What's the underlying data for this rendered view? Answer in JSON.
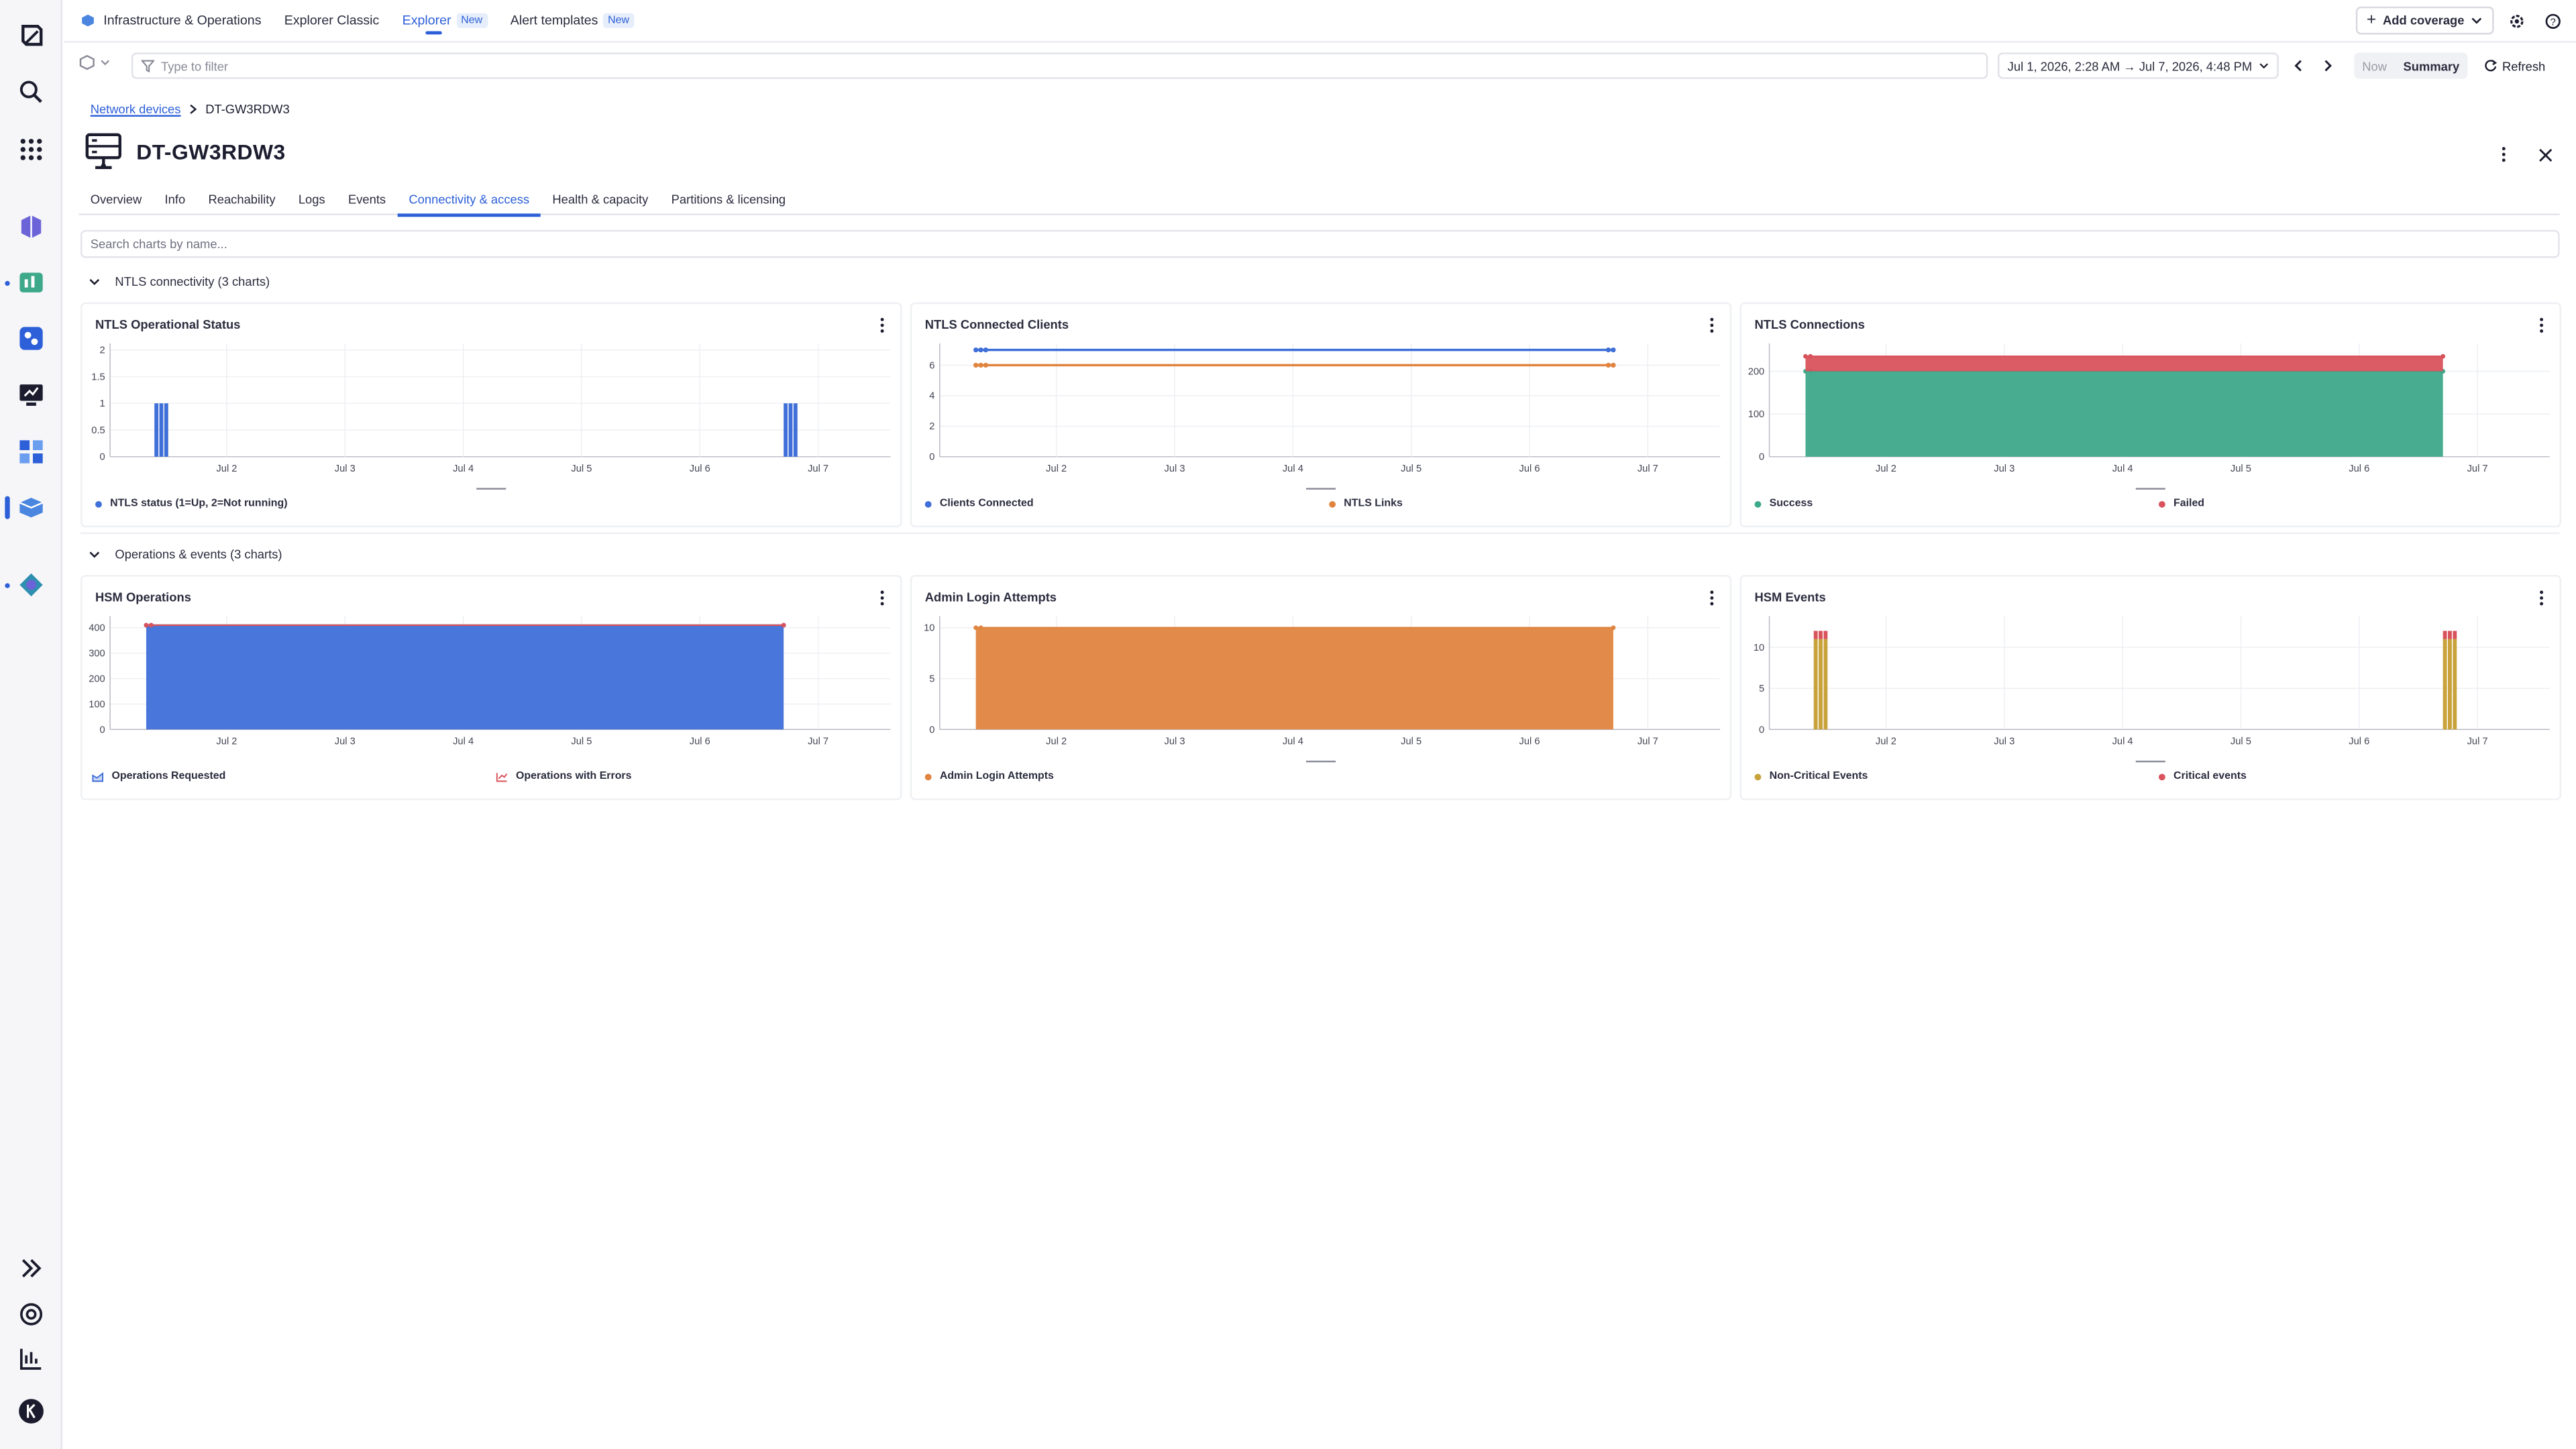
{
  "colors": {
    "accent": "#2c5fd8",
    "blue_series": "#3f6fd8",
    "orange_series": "#e0843f",
    "green_series": "#3ea98a",
    "red_series": "#d9535c",
    "olive_series": "#c8a23a"
  },
  "nav": {
    "app_name": "Infrastructure & Operations",
    "tabs": [
      {
        "label": "Explorer Classic",
        "badge": ""
      },
      {
        "label": "Explorer",
        "badge": "New"
      },
      {
        "label": "Alert templates",
        "badge": "New"
      }
    ],
    "add_coverage": "Add coverage"
  },
  "filter": {
    "placeholder": "Type to filter",
    "timeframe": "Jul 1, 2026, 2:28 AM → Jul 7, 2026, 4:48 PM",
    "now": "Now",
    "summary": "Summary",
    "refresh": "Refresh"
  },
  "breadcrumb": {
    "parent": "Network devices",
    "current": "DT-GW3RDW3"
  },
  "page": {
    "title": "DT-GW3RDW3"
  },
  "tabs": [
    "Overview",
    "Info",
    "Reachability",
    "Logs",
    "Events",
    "Connectivity & access",
    "Health & capacity",
    "Partitions & licensing"
  ],
  "search": {
    "placeholder": "Search charts by name..."
  },
  "sections": [
    {
      "title": "NTLS connectivity (3 charts)"
    },
    {
      "title": "Operations & events (3 charts)"
    }
  ],
  "chart_data": [
    {
      "type": "bar",
      "title": "NTLS Operational Status",
      "x_ticks": [
        "Jul 2",
        "Jul 3",
        "Jul 4",
        "Jul 5",
        "Jul 6",
        "Jul 7"
      ],
      "y_ticks": [
        "0",
        "0.5",
        "1",
        "1.5",
        "2"
      ],
      "ylim": [
        0,
        2
      ],
      "series": [
        {
          "name": "NTLS status (1=Up, 2=Not running)",
          "color": "#3f6fd8",
          "points": [
            {
              "x": "Jul 1",
              "y": 1
            },
            {
              "x": "Jul 6",
              "y": 1
            }
          ]
        }
      ],
      "legend": [
        "NTLS status (1=Up, 2=Not running)"
      ]
    },
    {
      "type": "line",
      "title": "NTLS Connected Clients",
      "x_ticks": [
        "Jul 2",
        "Jul 3",
        "Jul 4",
        "Jul 5",
        "Jul 6",
        "Jul 7"
      ],
      "y_ticks": [
        "0",
        "2",
        "4",
        "6"
      ],
      "ylim": [
        0,
        7
      ],
      "series": [
        {
          "name": "Clients Connected",
          "color": "#3f6fd8",
          "values": [
            7,
            7
          ]
        },
        {
          "name": "NTLS Links",
          "color": "#e0843f",
          "values": [
            6,
            6
          ]
        }
      ],
      "legend": [
        "Clients Connected",
        "NTLS Links"
      ]
    },
    {
      "type": "area",
      "title": "NTLS Connections",
      "x_ticks": [
        "Jul 2",
        "Jul 3",
        "Jul 4",
        "Jul 5",
        "Jul 6",
        "Jul 7"
      ],
      "y_ticks": [
        "0",
        "100",
        "200"
      ],
      "ylim": [
        0,
        250
      ],
      "series": [
        {
          "name": "Success",
          "color": "#3ea98a",
          "values": [
            200,
            200
          ]
        },
        {
          "name": "Failed",
          "color": "#d9535c",
          "values": [
            35,
            35
          ]
        }
      ],
      "legend": [
        "Success",
        "Failed"
      ]
    },
    {
      "type": "area",
      "title": "HSM Operations",
      "x_ticks": [
        "Jul 2",
        "Jul 3",
        "Jul 4",
        "Jul 5",
        "Jul 6",
        "Jul 7"
      ],
      "y_ticks": [
        "0",
        "100",
        "200",
        "300",
        "400"
      ],
      "ylim": [
        0,
        420
      ],
      "series": [
        {
          "name": "Operations Requested",
          "color": "#3f6fd8",
          "values": [
            410,
            410
          ]
        },
        {
          "name": "Operations with Errors",
          "color": "#d9535c",
          "values": [
            0,
            0
          ]
        }
      ],
      "legend": [
        "Operations Requested",
        "Operations with Errors"
      ]
    },
    {
      "type": "area",
      "title": "Admin Login Attempts",
      "x_ticks": [
        "Jul 2",
        "Jul 3",
        "Jul 4",
        "Jul 5",
        "Jul 6",
        "Jul 7"
      ],
      "y_ticks": [
        "0",
        "5",
        "10"
      ],
      "ylim": [
        0,
        10.5
      ],
      "series": [
        {
          "name": "Admin Login Attempts",
          "color": "#e0843f",
          "values": [
            10,
            10
          ]
        }
      ],
      "legend": [
        "Admin Login Attempts"
      ]
    },
    {
      "type": "bar",
      "title": "HSM Events",
      "x_ticks": [
        "Jul 2",
        "Jul 3",
        "Jul 4",
        "Jul 5",
        "Jul 6",
        "Jul 7"
      ],
      "y_ticks": [
        "0",
        "5",
        "10"
      ],
      "ylim": [
        0,
        13
      ],
      "series": [
        {
          "name": "Non-Critical Events",
          "color": "#c8a23a",
          "points": [
            {
              "x": "Jul 1",
              "y": 11
            },
            {
              "x": "Jul 6",
              "y": 11
            }
          ]
        },
        {
          "name": "Critical events",
          "color": "#d9535c",
          "points": [
            {
              "x": "Jul 1",
              "y": 1
            },
            {
              "x": "Jul 6",
              "y": 1
            }
          ]
        }
      ],
      "legend": [
        "Non-Critical Events",
        "Critical events"
      ]
    }
  ]
}
